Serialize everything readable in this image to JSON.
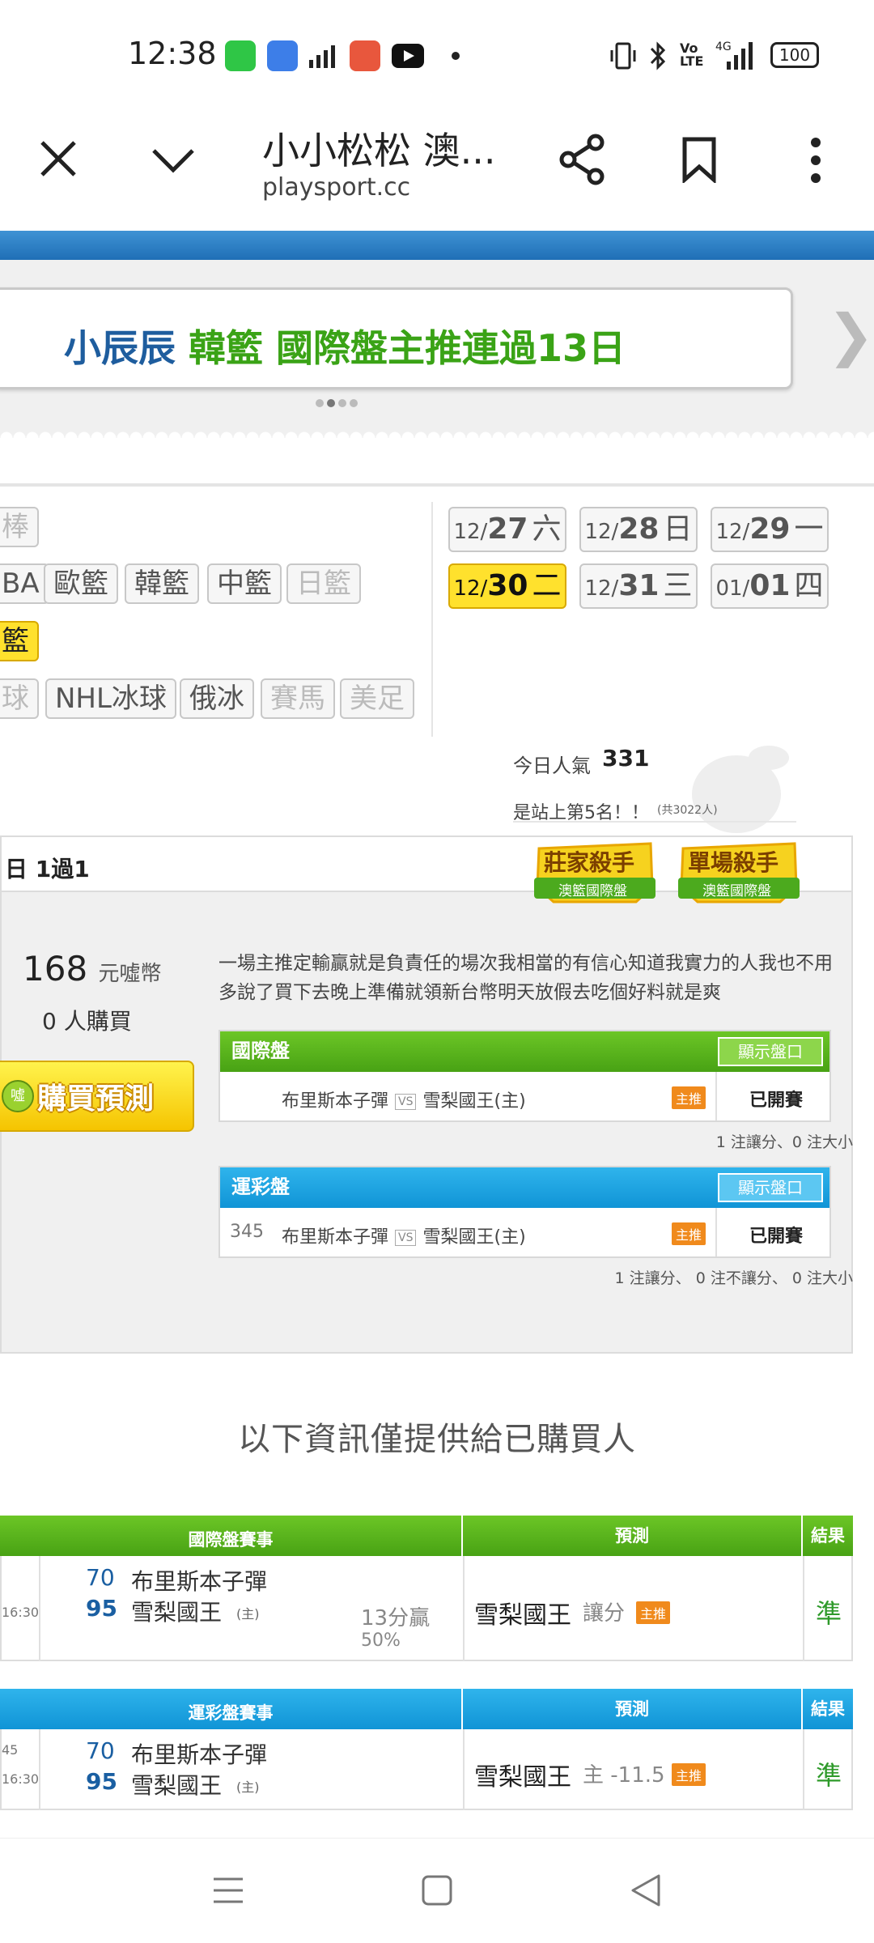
{
  "status": {
    "time": "12:38",
    "battery": "100"
  },
  "browser": {
    "title": "小小松松 澳...",
    "url": "playsport.cc"
  },
  "banner": {
    "part1": "小辰辰",
    "part2": "韓籃 國際盤主推連過13日"
  },
  "sports": {
    "row1": [
      "棒"
    ],
    "row2": [
      "BA",
      "歐籃",
      "韓籃",
      "中籃",
      "日籃"
    ],
    "row3": [
      "籃"
    ],
    "row4": [
      "球",
      "NHL冰球",
      "俄冰",
      "賽馬",
      "美足"
    ]
  },
  "dates": [
    {
      "m": "12/",
      "d": "27",
      "w": "六"
    },
    {
      "m": "12/",
      "d": "28",
      "w": "日"
    },
    {
      "m": "12/",
      "d": "29",
      "w": "一"
    },
    {
      "m": "12/",
      "d": "30",
      "w": "二"
    },
    {
      "m": "12/",
      "d": "31",
      "w": "三"
    },
    {
      "m": "01/",
      "d": "01",
      "w": "四"
    }
  ],
  "popularity": {
    "label": "今日人氣",
    "value": "331",
    "rank": "是站上第5名！！",
    "total": "(共3022人)"
  },
  "hero": {
    "record": "日 1過1",
    "badge1": "莊家殺手",
    "badge1sub": "澳籃國際盤",
    "badge2": "單場殺手",
    "badge2sub": "澳籃國際盤",
    "price": "168",
    "currency": "元噓幣",
    "buyers": "0 人購買",
    "buy": "購買預測",
    "coin": "噓",
    "desc": "一場主推定輸贏就是負責任的場次我相當的有信心知道我實力的人我也不用多說了買下去晚上準備就領新台幣明天放假去吃個好料就是爽"
  },
  "panel1": {
    "title": "國際盤",
    "show": "顯示盤口",
    "num": "",
    "away": "布里斯本子彈",
    "vs": "VS",
    "home": "雪梨國王(主)",
    "tag": "主推",
    "status": "已開賽",
    "note": "1 注讓分、0 注大小"
  },
  "panel2": {
    "title": "運彩盤",
    "show": "顯示盤口",
    "num": "345",
    "away": "布里斯本子彈",
    "vs": "VS",
    "home": "雪梨國王(主)",
    "tag": "主推",
    "status": "已開賽",
    "note": "1 注讓分、 0 注不讓分、 0 注大小"
  },
  "infoText": "以下資訊僅提供給已購買人",
  "table1": {
    "h1": "國際盤賽事",
    "h2": "預測",
    "h3": "結果",
    "time": "16:30",
    "s1": "70",
    "t1": "布里斯本子彈",
    "s2": "95",
    "t2": "雪梨國王",
    "host": "(主)",
    "margin": "13分贏",
    "pct": "50%",
    "pick": "雪梨國王",
    "pickType": "讓分",
    "tag": "主推",
    "result": "準"
  },
  "table2": {
    "h1": "運彩盤賽事",
    "h2": "預測",
    "h3": "結果",
    "num": "45",
    "time": "16:30",
    "s1": "70",
    "t1": "布里斯本子彈",
    "s2": "95",
    "t2": "雪梨國王",
    "host": "(主)",
    "pick": "雪梨國王",
    "pickType": "主 -11.5",
    "tag": "主推",
    "result": "準"
  }
}
